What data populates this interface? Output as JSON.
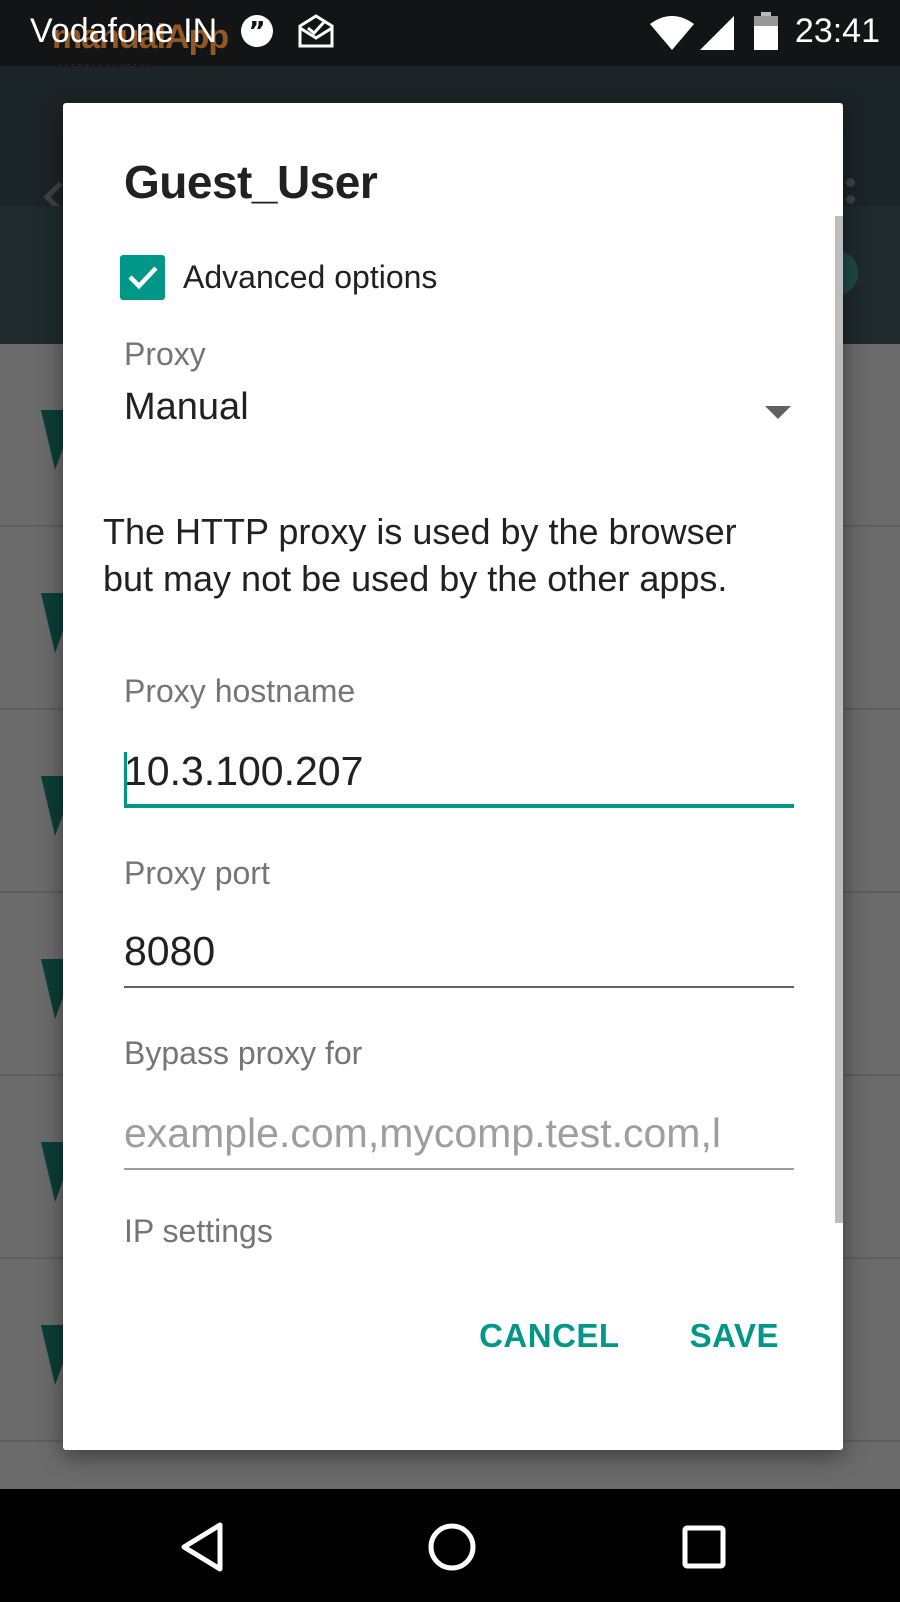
{
  "status_bar": {
    "carrier": "Vodafone IN",
    "watermark": "ma​nualApp",
    "time": "23:41",
    "icons": [
      "quote-notification-icon",
      "mail-notification-icon",
      "wifi-icon",
      "signal-icon",
      "battery-icon"
    ]
  },
  "dialog": {
    "title": "Guest_User",
    "advanced_options": {
      "label": "Advanced options",
      "checked": true
    },
    "proxy": {
      "label": "Proxy",
      "value": "Manual"
    },
    "info_text": "The HTTP proxy is used by the browser but may not be used by the other apps.",
    "proxy_hostname": {
      "label": "Proxy hostname",
      "value": "10.3.100.207"
    },
    "proxy_port": {
      "label": "Proxy port",
      "value": "8080"
    },
    "bypass_proxy": {
      "label": "Bypass proxy for",
      "placeholder": "example.com,mycomp.test.com,l"
    },
    "ip_settings": {
      "label": "IP settings"
    },
    "actions": {
      "cancel": "CANCEL",
      "save": "SAVE"
    }
  },
  "colors": {
    "accent": "#009688",
    "dialog_background": "#ffffff",
    "scrim": "#6b6b6b"
  },
  "navigation": {
    "icons": [
      "back-icon",
      "home-icon",
      "recents-icon"
    ]
  }
}
